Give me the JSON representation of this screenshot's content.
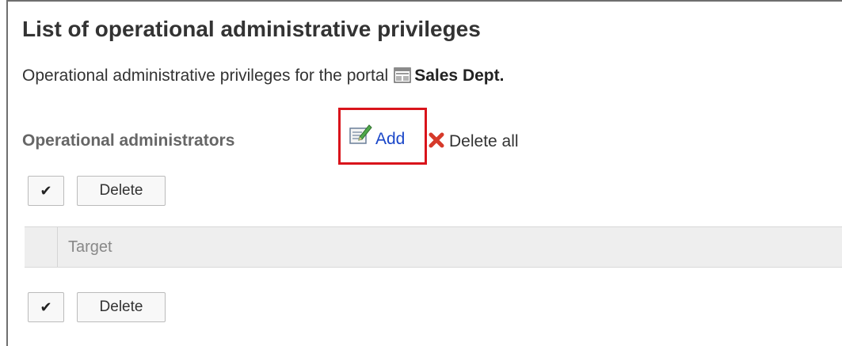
{
  "page": {
    "title": "List of operational administrative privileges",
    "description": "Operational administrative privileges for the portal",
    "portal_name": "Sales Dept."
  },
  "section": {
    "label": "Operational administrators",
    "add_label": "Add",
    "delete_all_label": "Delete all"
  },
  "toolbar_top": {
    "check_symbol": "✔",
    "delete_label": "Delete"
  },
  "table": {
    "columns": [
      "Target"
    ]
  },
  "toolbar_bottom": {
    "check_symbol": "✔",
    "delete_label": "Delete"
  },
  "colors": {
    "highlight_border": "#d9141b",
    "link": "#1a47c9",
    "header_bg": "#eeeeee"
  },
  "icons": {
    "portal": "portal-icon",
    "add": "edit-add-icon",
    "delete_all": "red-x-icon"
  }
}
